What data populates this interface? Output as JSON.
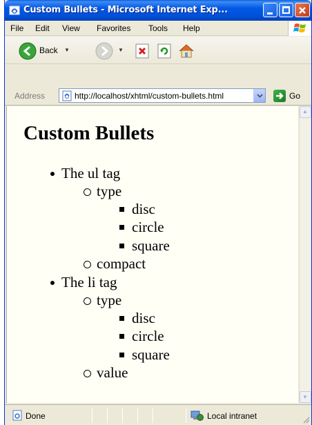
{
  "window": {
    "title": "Custom Bullets - Microsoft Internet Exp...",
    "icons": [
      "ie-icon",
      "minimize-icon",
      "maximize-icon",
      "close-icon"
    ]
  },
  "menubar": {
    "items": [
      "File",
      "Edit",
      "View",
      "Favorites",
      "Tools",
      "Help"
    ]
  },
  "toolbar": {
    "back_label": "Back",
    "icons": [
      "back-icon",
      "forward-icon",
      "stop-icon",
      "refresh-icon",
      "home-icon"
    ]
  },
  "addressbar": {
    "label": "Address",
    "url": "http://localhost/xhtml/custom-bullets.html",
    "go_label": "Go"
  },
  "page": {
    "heading": "Custom Bullets",
    "list": [
      {
        "text": "The ul tag",
        "children": [
          {
            "text": "type",
            "children": [
              "disc",
              "circle",
              "square"
            ]
          },
          {
            "text": "compact"
          }
        ]
      },
      {
        "text": "The li tag",
        "children": [
          {
            "text": "type",
            "children": [
              "disc",
              "circle",
              "square"
            ]
          },
          {
            "text": "value"
          }
        ]
      }
    ]
  },
  "statusbar": {
    "status": "Done",
    "zone": "Local intranet"
  },
  "colors": {
    "titlebar": "#0058e6",
    "chrome": "#ece9d8",
    "content_bg": "#fffff6"
  }
}
